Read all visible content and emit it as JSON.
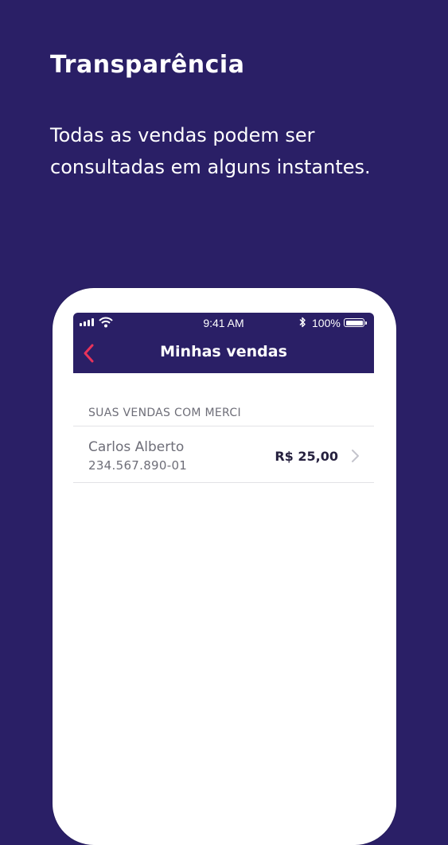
{
  "headline": "Transparência",
  "subtitle": " Todas as vendas podem ser consultadas em alguns instantes.",
  "colors": {
    "background": "#2a1f66",
    "accent": "#e8335a",
    "text_muted": "#6e6e78"
  },
  "status_bar": {
    "time": "9:41 AM",
    "battery": "100%",
    "icons": [
      "signal-icon",
      "wifi-icon",
      "bluetooth-icon",
      "battery-icon"
    ]
  },
  "nav": {
    "title": "Minhas vendas",
    "back_icon": "chevron-left-icon"
  },
  "sales": {
    "section_header": "SUAS VENDAS COM MERCI",
    "items": [
      {
        "name": "Carlos Alberto",
        "document": "234.567.890-01",
        "amount": "R$ 25,00"
      }
    ]
  }
}
